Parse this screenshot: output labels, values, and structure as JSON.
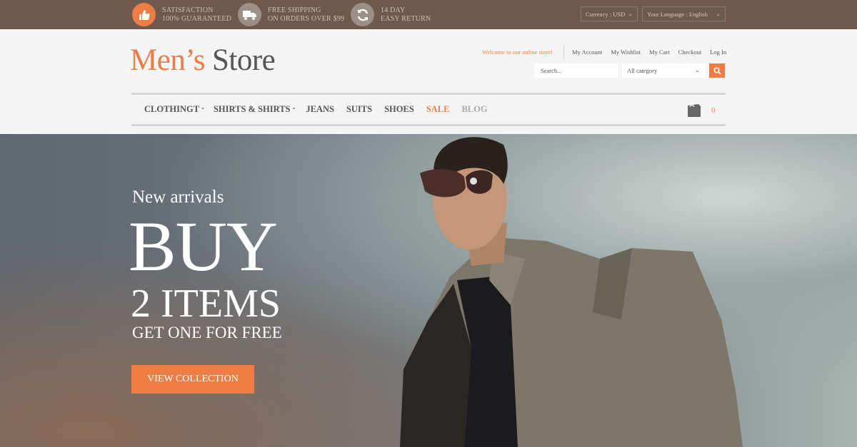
{
  "topbar": {
    "features": [
      {
        "icon": "thumbs-up-icon",
        "line1": "SATISFACTION",
        "line2": "100% GUARANTEED"
      },
      {
        "icon": "truck-icon",
        "line1": "FREE SHIPPING",
        "line2": "ON ORDERS OVER $99"
      },
      {
        "icon": "refresh-icon",
        "line1": "14 DAY",
        "line2": "EASY RETURN"
      }
    ],
    "currency": "Currency : USD",
    "language": "Your Language : English"
  },
  "header": {
    "logo_part1": "Men’s",
    "logo_part2": "Store",
    "welcome": "Welcome to our online store!",
    "links": [
      "My Account",
      "My Wishlist",
      "My Cart",
      "Checkout",
      "Log In"
    ],
    "search_placeholder": "Search...",
    "category": "All category"
  },
  "nav": {
    "items": [
      "CLOTHINGT",
      "SHIRTS & SHIRTS",
      "JEANS",
      "SUITS",
      "SHOES",
      "SALE",
      "BLOG"
    ],
    "cart_count": "0"
  },
  "hero": {
    "kicker": "New arrivals",
    "headline": "BUY",
    "sub": "2 ITEMS",
    "tagline": "GET ONE FOR FREE",
    "cta": "VIEW COLLECTION"
  },
  "colors": {
    "accent": "#ee7d45",
    "topbar": "#6e5a4c",
    "header_bg": "#f5f5f5"
  }
}
